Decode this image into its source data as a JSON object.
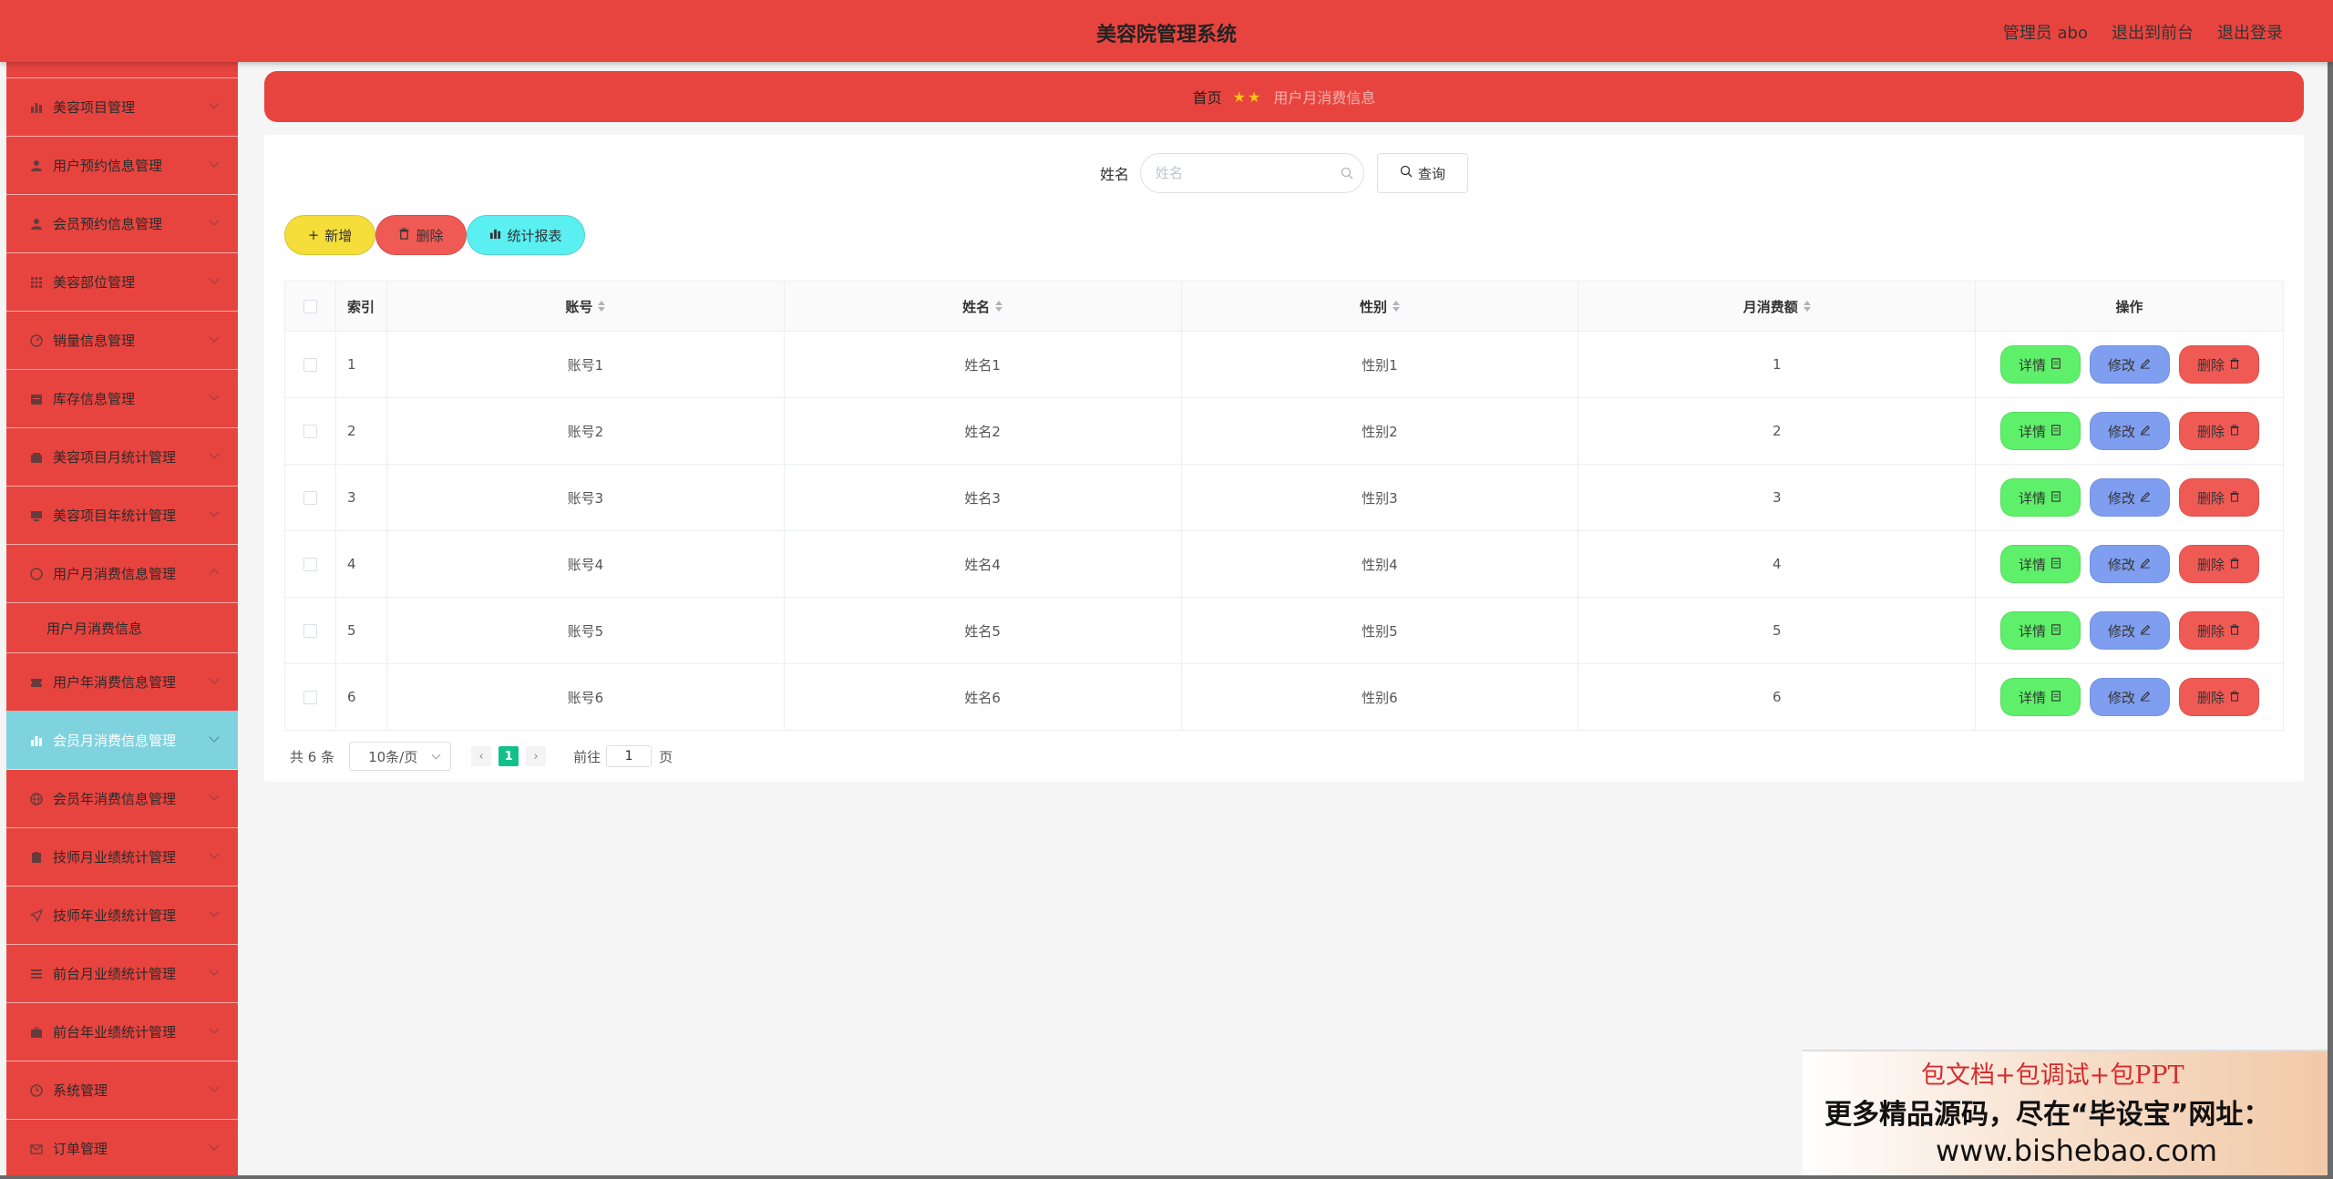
{
  "header": {
    "title": "美容院管理系统",
    "admin": "管理员 abo",
    "to_front": "退出到前台",
    "logout": "退出登录"
  },
  "sidebar": {
    "items": [
      {
        "label": "美容项目管理",
        "icon": "bar-chart-icon"
      },
      {
        "label": "用户预约信息管理",
        "icon": "user-icon"
      },
      {
        "label": "会员预约信息管理",
        "icon": "user-icon"
      },
      {
        "label": "美容部位管理",
        "icon": "grid-icon"
      },
      {
        "label": "销量信息管理",
        "icon": "gauge-icon"
      },
      {
        "label": "库存信息管理",
        "icon": "calendar-icon"
      },
      {
        "label": "美容项目月统计管理",
        "icon": "wallet-icon"
      },
      {
        "label": "美容项目年统计管理",
        "icon": "monitor-icon"
      },
      {
        "label": "用户月消费信息管理",
        "icon": "circle-icon"
      },
      {
        "label": "用户年消费信息管理",
        "icon": "ticket-icon"
      },
      {
        "label": "会员月消费信息管理",
        "icon": "bar-chart-icon"
      },
      {
        "label": "会员年消费信息管理",
        "icon": "globe-icon"
      },
      {
        "label": "技师月业绩统计管理",
        "icon": "clipboard-icon"
      },
      {
        "label": "技师年业绩统计管理",
        "icon": "send-icon"
      },
      {
        "label": "前台月业绩统计管理",
        "icon": "list-icon"
      },
      {
        "label": "前台年业绩统计管理",
        "icon": "briefcase-icon"
      },
      {
        "label": "系统管理",
        "icon": "clock-icon"
      },
      {
        "label": "订单管理",
        "icon": "mail-icon"
      }
    ],
    "sub_item": "用户月消费信息"
  },
  "breadcrumb": {
    "home": "首页",
    "current": "用户月消费信息"
  },
  "search": {
    "label": "姓名",
    "placeholder": "姓名",
    "button": "查询"
  },
  "actions": {
    "add": "新增",
    "delete": "删除",
    "report": "统计报表"
  },
  "table": {
    "headers": {
      "index": "索引",
      "account": "账号",
      "name": "姓名",
      "gender": "性别",
      "amount": "月消费额",
      "ops": "操作"
    },
    "rows": [
      {
        "index": "1",
        "account": "账号1",
        "name": "姓名1",
        "gender": "性别1",
        "amount": "1"
      },
      {
        "index": "2",
        "account": "账号2",
        "name": "姓名2",
        "gender": "性别2",
        "amount": "2"
      },
      {
        "index": "3",
        "account": "账号3",
        "name": "姓名3",
        "gender": "性别3",
        "amount": "3"
      },
      {
        "index": "4",
        "account": "账号4",
        "name": "姓名4",
        "gender": "性别4",
        "amount": "4"
      },
      {
        "index": "5",
        "account": "账号5",
        "name": "姓名5",
        "gender": "性别5",
        "amount": "5"
      },
      {
        "index": "6",
        "account": "账号6",
        "name": "姓名6",
        "gender": "性别6",
        "amount": "6"
      }
    ],
    "op_labels": {
      "detail": "详情",
      "edit": "修改",
      "remove": "删除"
    }
  },
  "pager": {
    "total": "共 6 条",
    "page_size": "10条/页",
    "current_page": "1",
    "goto_label": "前往",
    "goto_value": "1",
    "page_suffix": "页"
  },
  "promo": {
    "line1": "包文档+包调试+包PPT",
    "line2": "更多精品源码，尽在“毕设宝”网址：",
    "line3": "www.bishebao.com"
  },
  "colors": {
    "brand": "#e8443f",
    "active_menu": "#7fd3df",
    "add": "#f5dd3a",
    "delete": "#ef5a55",
    "report": "#5af0f2",
    "detail": "#5ef06a",
    "edit": "#7f9ef0",
    "page_active": "#13c08a"
  }
}
